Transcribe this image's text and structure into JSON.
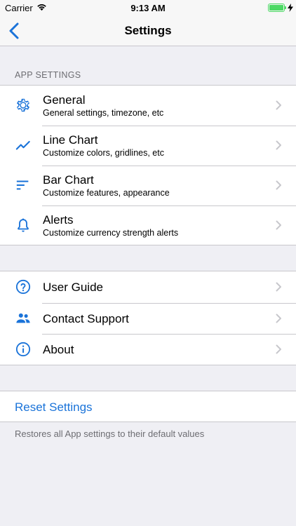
{
  "status_bar": {
    "carrier": "Carrier",
    "time": "9:13 AM",
    "battery_level": 1.0,
    "battery_color": "#4cd964"
  },
  "nav": {
    "back_icon": "chevron-left-icon",
    "title": "Settings",
    "accent": "#1a73d9"
  },
  "app_settings": {
    "header": "APP SETTINGS",
    "items": [
      {
        "icon": "gear-icon",
        "title": "General",
        "subtitle": "General settings, timezone, etc"
      },
      {
        "icon": "line-chart-icon",
        "title": "Line Chart",
        "subtitle": "Customize colors, gridlines, etc"
      },
      {
        "icon": "bar-chart-icon",
        "title": "Bar Chart",
        "subtitle": "Customize features, appearance"
      },
      {
        "icon": "bell-icon",
        "title": "Alerts",
        "subtitle": "Customize currency strength alerts"
      }
    ]
  },
  "support": {
    "items": [
      {
        "icon": "help-icon",
        "title": "User Guide"
      },
      {
        "icon": "people-icon",
        "title": "Contact Support"
      },
      {
        "icon": "info-icon",
        "title": "About"
      }
    ]
  },
  "reset": {
    "label": "Reset Settings",
    "note": "Restores all App settings to their default values"
  }
}
